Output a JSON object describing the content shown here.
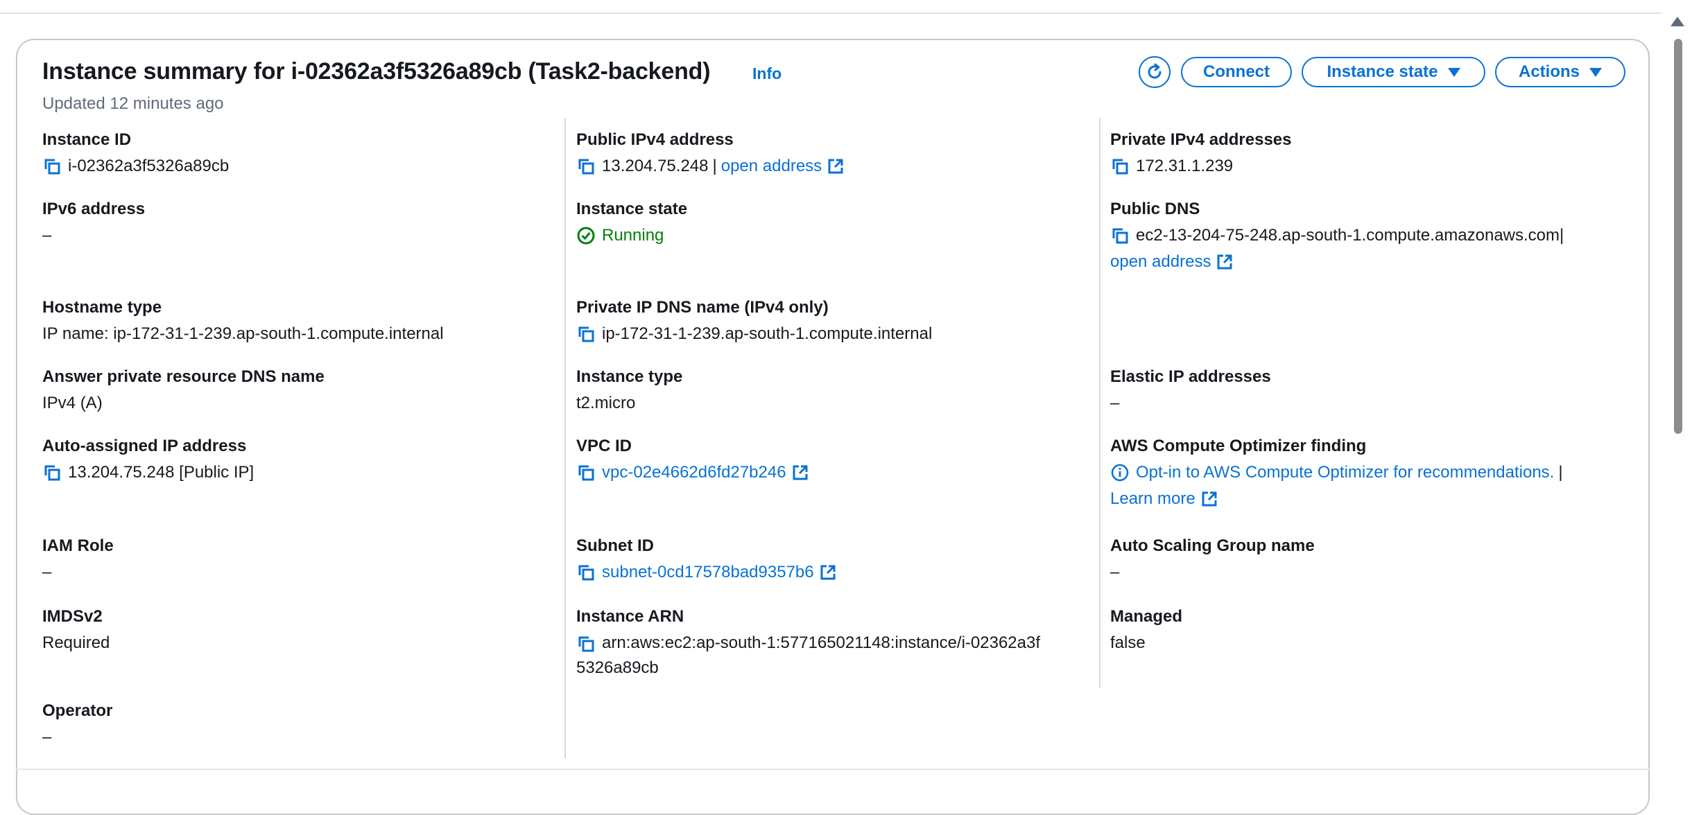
{
  "header": {
    "title": "Instance summary for i-02362a3f5326a89cb (Task2-backend)",
    "info_link": "Info",
    "updated": "Updated 12 minutes ago",
    "buttons": {
      "connect": "Connect",
      "instance_state": "Instance state",
      "actions": "Actions"
    }
  },
  "col1": {
    "instance_id": {
      "label": "Instance ID",
      "value": "i-02362a3f5326a89cb"
    },
    "ipv6": {
      "label": "IPv6 address",
      "value": "–"
    },
    "hostname_type": {
      "label": "Hostname type",
      "value": "IP name: ip-172-31-1-239.ap-south-1.compute.internal"
    },
    "answer_dns": {
      "label": "Answer private resource DNS name",
      "value": "IPv4 (A)"
    },
    "auto_ip": {
      "label": "Auto-assigned IP address",
      "value": "13.204.75.248 [Public IP]"
    },
    "iam_role": {
      "label": "IAM Role",
      "value": "–"
    },
    "imdsv2": {
      "label": "IMDSv2",
      "value": "Required"
    },
    "operator": {
      "label": "Operator",
      "value": "–"
    }
  },
  "col2": {
    "public_ipv4": {
      "label": "Public IPv4 address",
      "value": "13.204.75.248",
      "separator": "|",
      "link": "open address"
    },
    "instance_state": {
      "label": "Instance state",
      "value": "Running",
      "status_color": "#037f0c"
    },
    "private_dns": {
      "label": "Private IP DNS name (IPv4 only)",
      "value": "ip-172-31-1-239.ap-south-1.compute.internal"
    },
    "instance_type": {
      "label": "Instance type",
      "value": "t2.micro"
    },
    "vpc_id": {
      "label": "VPC ID",
      "value": "vpc-02e4662d6fd27b246"
    },
    "subnet_id": {
      "label": "Subnet ID",
      "value": "subnet-0cd17578bad9357b6"
    },
    "arn": {
      "label": "Instance ARN",
      "line1": "arn:aws:ec2:ap-south-1:577165021148:instance/i-02362a3f",
      "line2": "5326a89cb"
    }
  },
  "col3": {
    "private_ipv4": {
      "label": "Private IPv4 addresses",
      "value": "172.31.1.239"
    },
    "public_dns": {
      "label": "Public DNS",
      "value": "ec2-13-204-75-248.ap-south-1.compute.amazonaws.com",
      "separator": "|",
      "link": "open address"
    },
    "elastic_ip": {
      "label": "Elastic IP addresses",
      "value": "–"
    },
    "optimizer": {
      "label": "AWS Compute Optimizer finding",
      "link": "Opt-in to AWS Compute Optimizer for recommendations.",
      "separator": "|",
      "learn_more": "Learn more"
    },
    "asg_name": {
      "label": "Auto Scaling Group name",
      "value": "–"
    },
    "managed": {
      "label": "Managed",
      "value": "false"
    }
  },
  "icons": {
    "copy": "copy-icon",
    "external": "external-link-icon",
    "refresh": "refresh-icon",
    "running": "check-circle-icon",
    "info": "info-circle-icon"
  },
  "colors": {
    "accent": "#0972d3",
    "success": "#037f0c",
    "text": "#16191f",
    "muted": "#5f6b7a"
  }
}
